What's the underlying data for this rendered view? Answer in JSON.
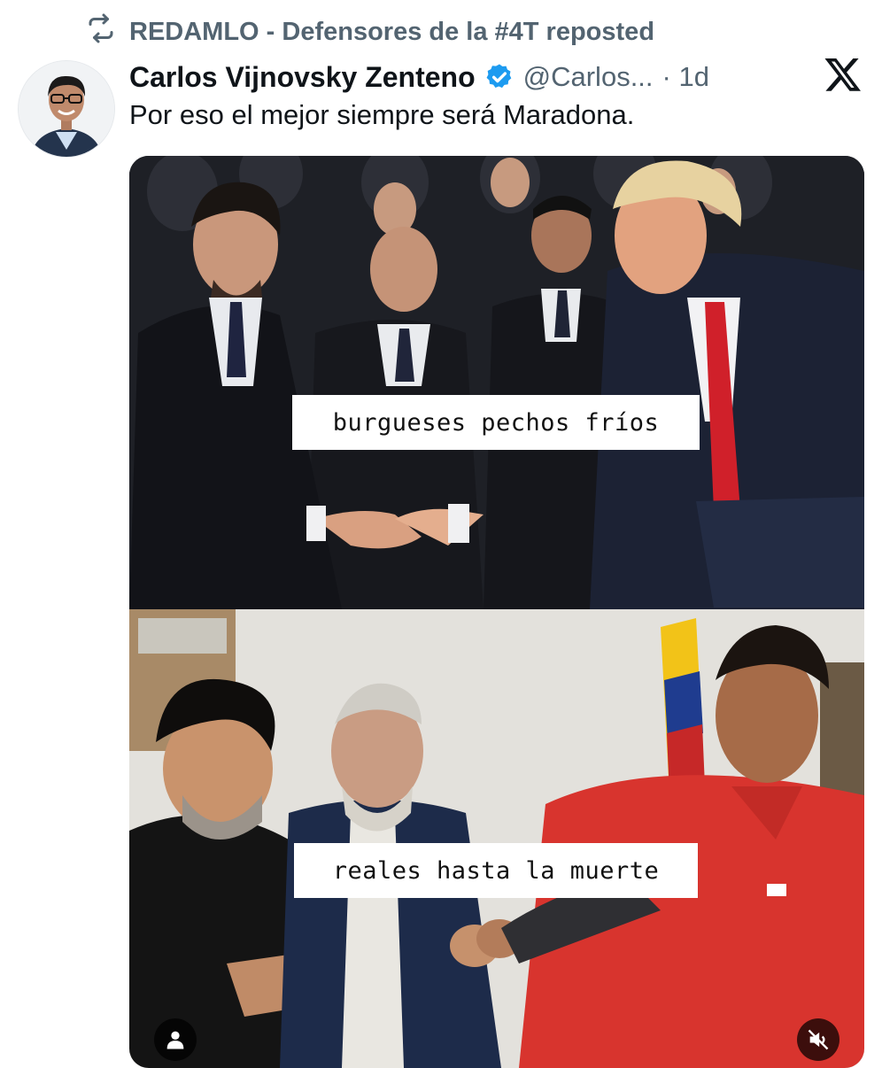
{
  "repost": {
    "icon": "repost-icon",
    "text": "REDAMLO - Defensores de la #4T reposted"
  },
  "tweet": {
    "author_name": "Carlos Vijnovsky Zenteno",
    "verified_icon": "verified-badge-icon",
    "handle": "@Carlos...",
    "time": "· 1d",
    "text": "Por eso el mejor siempre será Maradona."
  },
  "brand": {
    "logo_icon": "x-logo-icon"
  },
  "media": {
    "top_caption": "burgueses pechos fríos",
    "bottom_caption": "reales hasta la muerte",
    "alt_button_icon": "person-icon",
    "mute_button_icon": "speaker-muted-icon"
  },
  "colors": {
    "text_primary": "#0f1419",
    "text_secondary": "#536471",
    "verified_blue": "#1d9bf0",
    "tie_red": "#d0202a",
    "jacket_red": "#d8342e"
  }
}
